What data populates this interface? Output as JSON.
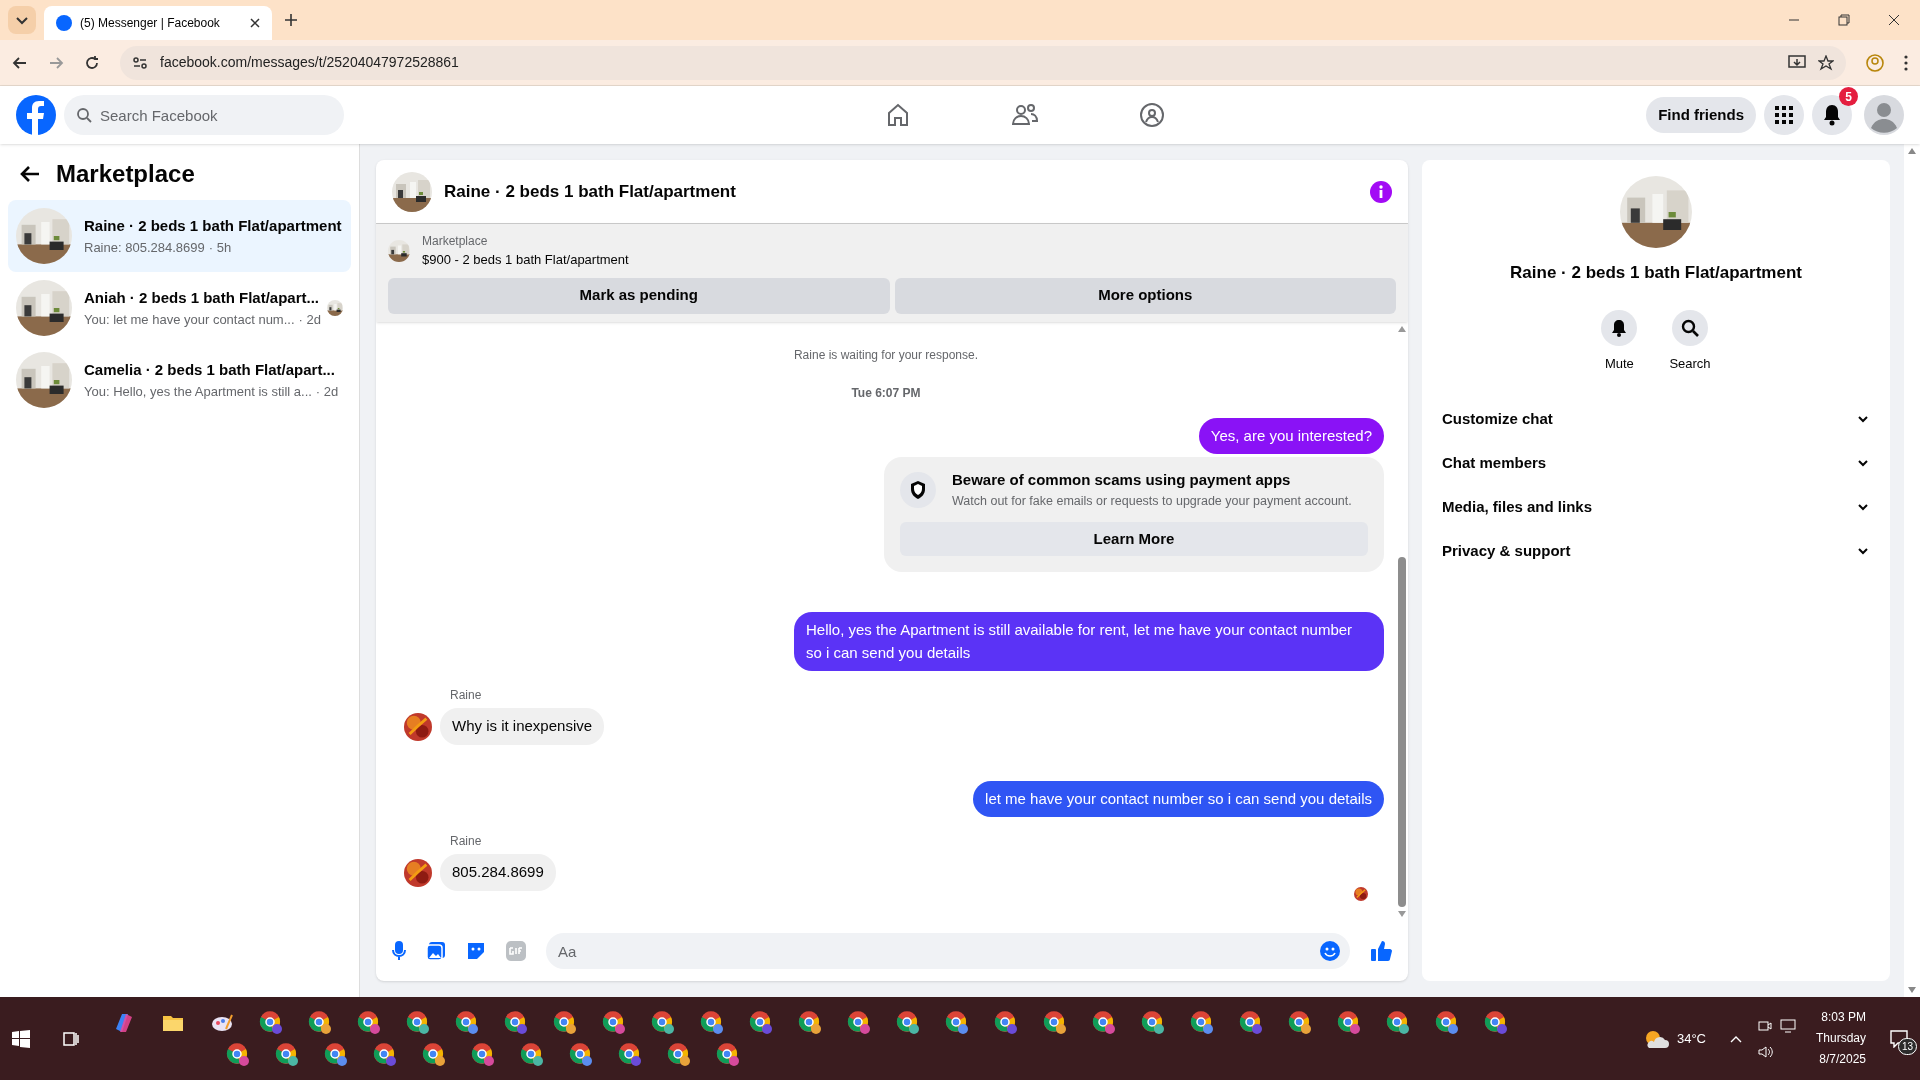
{
  "browser": {
    "tab_title": "(5) Messenger | Facebook",
    "url": "facebook.com/messages/t/25204047972528861"
  },
  "header": {
    "search_placeholder": "Search Facebook",
    "find_friends": "Find friends",
    "notification_count": "5"
  },
  "sidebar": {
    "title": "Marketplace",
    "conversations": [
      {
        "name": "Raine · 2 beds 1 bath Flat/apartment",
        "preview": "Raine: 805.284.8699",
        "time": "· 5h",
        "selected": true,
        "seen": false
      },
      {
        "name": "Aniah · 2 beds 1 bath Flat/apart...",
        "preview": "You: let me have your contact num...",
        "time": "· 2d",
        "selected": false,
        "seen": true
      },
      {
        "name": "Camelia · 2 beds 1 bath Flat/apart...",
        "preview": "You: Hello, yes the Apartment is still a...",
        "time": "· 2d",
        "selected": false,
        "seen": false
      }
    ]
  },
  "chat": {
    "title": "Raine · 2 beds 1 bath Flat/apartment",
    "listing": {
      "label": "Marketplace",
      "title": "$900 - 2 beds 1 bath Flat/apartment"
    },
    "actions": [
      "Mark as pending",
      "More options"
    ],
    "messages": [
      {
        "kind": "status",
        "text": "Raine is waiting for your response."
      },
      {
        "kind": "time",
        "text": "Tue 6:07 PM"
      },
      {
        "kind": "sent",
        "text": "Yes, are you interested?",
        "color": "#8a12f6"
      },
      {
        "kind": "notice",
        "title": "Beware of common scams using payment apps",
        "text": "Watch out for fake emails or requests to upgrade your payment account.",
        "button": "Learn More"
      },
      {
        "kind": "sent",
        "text": "Hello, yes the Apartment is still available for rent, let me have your contact number so i can send you details",
        "color": "#5b33f6"
      },
      {
        "kind": "received",
        "sender": "Raine",
        "text": "Why is it inexpensive"
      },
      {
        "kind": "sent",
        "text": "let me have your contact number so i can send you details",
        "color": "#2f55f4"
      },
      {
        "kind": "received",
        "sender": "Raine",
        "text": "805.284.8699"
      }
    ],
    "composer_placeholder": "Aa"
  },
  "details": {
    "title": "Raine · 2 beds 1 bath Flat/apartment",
    "actions": [
      "Mute",
      "Search"
    ],
    "sections": [
      {
        "label": "Customize chat",
        "expanded": false
      },
      {
        "label": "Chat members",
        "expanded": false
      },
      {
        "label": "Media, files and links",
        "expanded": false
      },
      {
        "label": "Privacy & support",
        "expanded": false
      }
    ]
  },
  "taskbar": {
    "temperature": "34°C",
    "time": "8:03 PM",
    "day": "Thursday",
    "date": "8/7/2025",
    "notification_count": "13"
  }
}
